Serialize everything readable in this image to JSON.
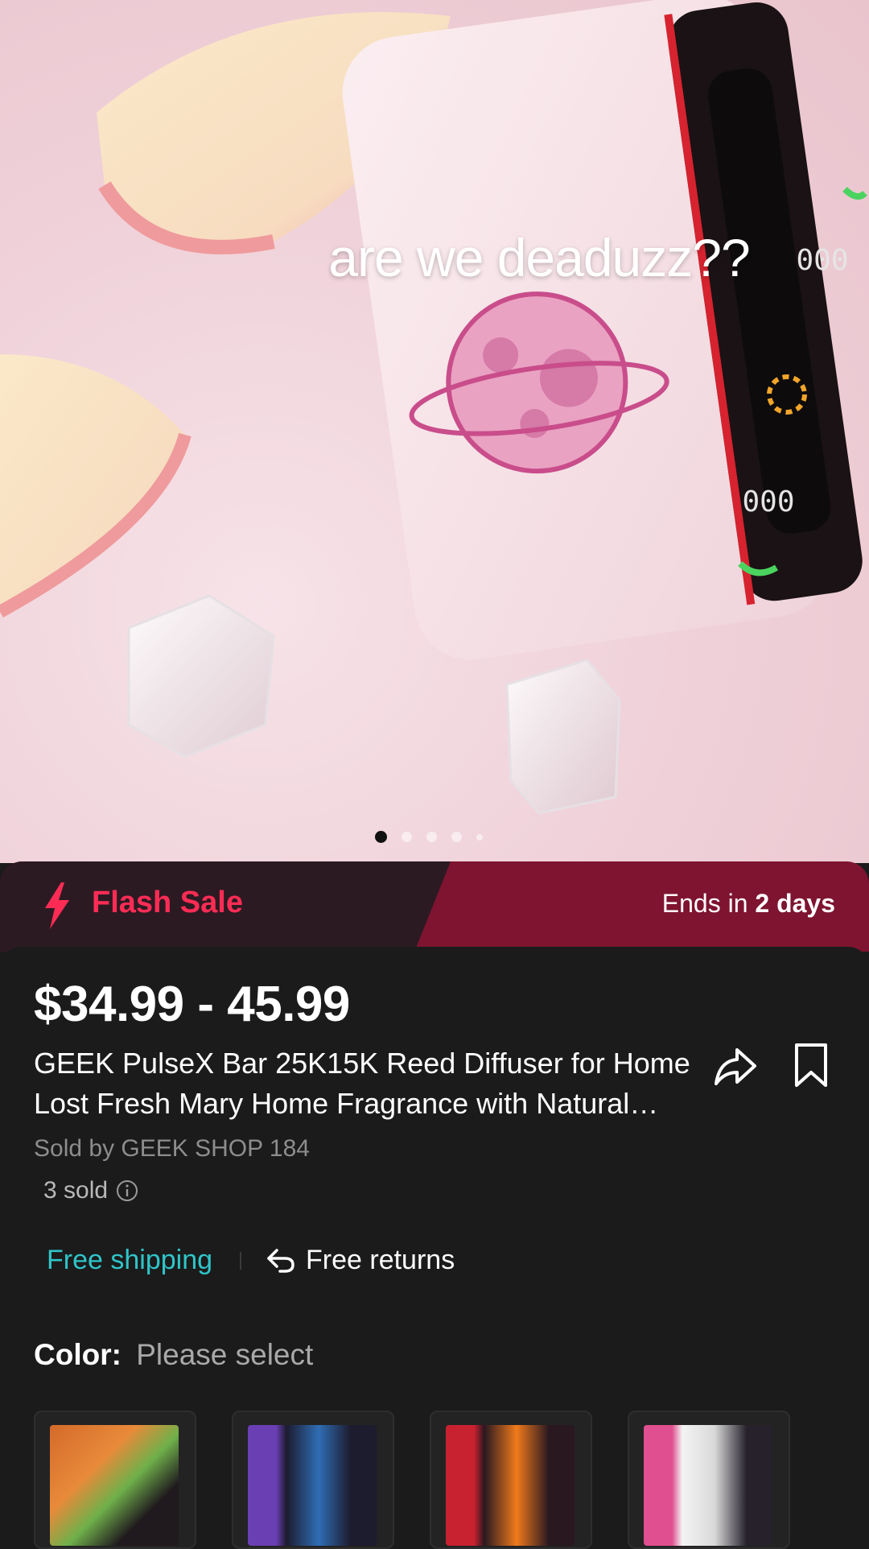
{
  "hero": {
    "caption": "are we deaduzz??",
    "device_screen_readout_top": "000",
    "device_screen_readout_bottom": "000",
    "carousel": {
      "total": 5,
      "active_index": 0
    }
  },
  "flash_sale": {
    "label": "Flash Sale",
    "ends_prefix": "Ends in ",
    "ends_value": "2 days",
    "color_accent": "#fe2c55",
    "color_bg": "#7e1430"
  },
  "product": {
    "price": "$34.99 - 45.99",
    "title": "GEEK PulseX Bar 25K15K Reed Diffuser for Home Lost Fresh Mary Home Fragrance with Natural Sticks",
    "seller": "Sold by GEEK SHOP 184",
    "sold": "3 sold",
    "share_icon": "share-arrow-icon",
    "save_icon": "bookmark-icon"
  },
  "shipping": {
    "free_shipping": "Free shipping",
    "free_returns": "Free returns",
    "color_free_shipping": "#2fc5c9"
  },
  "variant": {
    "label": "Color:",
    "value": "Please select",
    "thumbnails": [
      {
        "name": "variant-orange-green",
        "colors": [
          "#d46a2a",
          "#6fb04a",
          "#201a1e"
        ]
      },
      {
        "name": "variant-purple-blue",
        "colors": [
          "#6a3fb3",
          "#2f6db5",
          "#1d1b2e"
        ]
      },
      {
        "name": "variant-red-orange",
        "colors": [
          "#c8212f",
          "#f07a1c",
          "#2a1820"
        ]
      },
      {
        "name": "variant-pink-silver",
        "colors": [
          "#e04f8f",
          "#d9d9d9",
          "#26212b"
        ]
      }
    ]
  }
}
